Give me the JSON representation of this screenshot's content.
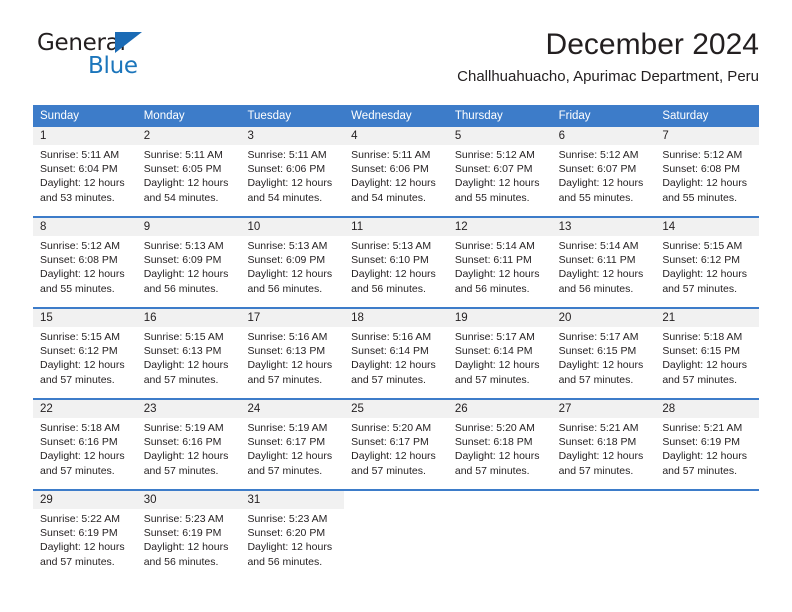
{
  "brand": {
    "name_top": "General",
    "name_bottom": "Blue",
    "triangle_color": "#1b6bb5",
    "blue_color": "#1b75bb"
  },
  "header": {
    "title": "December 2024",
    "location": "Challhuahuacho, Apurimac Department, Peru"
  },
  "calendar": {
    "header_color": "#3d7cc9",
    "daynum_bg": "#f1f1f1",
    "weekdays": [
      "Sunday",
      "Monday",
      "Tuesday",
      "Wednesday",
      "Thursday",
      "Friday",
      "Saturday"
    ],
    "weeks": [
      [
        {
          "day": "1",
          "sunrise": "Sunrise: 5:11 AM",
          "sunset": "Sunset: 6:04 PM",
          "daylight1": "Daylight: 12 hours",
          "daylight2": "and 53 minutes."
        },
        {
          "day": "2",
          "sunrise": "Sunrise: 5:11 AM",
          "sunset": "Sunset: 6:05 PM",
          "daylight1": "Daylight: 12 hours",
          "daylight2": "and 54 minutes."
        },
        {
          "day": "3",
          "sunrise": "Sunrise: 5:11 AM",
          "sunset": "Sunset: 6:06 PM",
          "daylight1": "Daylight: 12 hours",
          "daylight2": "and 54 minutes."
        },
        {
          "day": "4",
          "sunrise": "Sunrise: 5:11 AM",
          "sunset": "Sunset: 6:06 PM",
          "daylight1": "Daylight: 12 hours",
          "daylight2": "and 54 minutes."
        },
        {
          "day": "5",
          "sunrise": "Sunrise: 5:12 AM",
          "sunset": "Sunset: 6:07 PM",
          "daylight1": "Daylight: 12 hours",
          "daylight2": "and 55 minutes."
        },
        {
          "day": "6",
          "sunrise": "Sunrise: 5:12 AM",
          "sunset": "Sunset: 6:07 PM",
          "daylight1": "Daylight: 12 hours",
          "daylight2": "and 55 minutes."
        },
        {
          "day": "7",
          "sunrise": "Sunrise: 5:12 AM",
          "sunset": "Sunset: 6:08 PM",
          "daylight1": "Daylight: 12 hours",
          "daylight2": "and 55 minutes."
        }
      ],
      [
        {
          "day": "8",
          "sunrise": "Sunrise: 5:12 AM",
          "sunset": "Sunset: 6:08 PM",
          "daylight1": "Daylight: 12 hours",
          "daylight2": "and 55 minutes."
        },
        {
          "day": "9",
          "sunrise": "Sunrise: 5:13 AM",
          "sunset": "Sunset: 6:09 PM",
          "daylight1": "Daylight: 12 hours",
          "daylight2": "and 56 minutes."
        },
        {
          "day": "10",
          "sunrise": "Sunrise: 5:13 AM",
          "sunset": "Sunset: 6:09 PM",
          "daylight1": "Daylight: 12 hours",
          "daylight2": "and 56 minutes."
        },
        {
          "day": "11",
          "sunrise": "Sunrise: 5:13 AM",
          "sunset": "Sunset: 6:10 PM",
          "daylight1": "Daylight: 12 hours",
          "daylight2": "and 56 minutes."
        },
        {
          "day": "12",
          "sunrise": "Sunrise: 5:14 AM",
          "sunset": "Sunset: 6:11 PM",
          "daylight1": "Daylight: 12 hours",
          "daylight2": "and 56 minutes."
        },
        {
          "day": "13",
          "sunrise": "Sunrise: 5:14 AM",
          "sunset": "Sunset: 6:11 PM",
          "daylight1": "Daylight: 12 hours",
          "daylight2": "and 56 minutes."
        },
        {
          "day": "14",
          "sunrise": "Sunrise: 5:15 AM",
          "sunset": "Sunset: 6:12 PM",
          "daylight1": "Daylight: 12 hours",
          "daylight2": "and 57 minutes."
        }
      ],
      [
        {
          "day": "15",
          "sunrise": "Sunrise: 5:15 AM",
          "sunset": "Sunset: 6:12 PM",
          "daylight1": "Daylight: 12 hours",
          "daylight2": "and 57 minutes."
        },
        {
          "day": "16",
          "sunrise": "Sunrise: 5:15 AM",
          "sunset": "Sunset: 6:13 PM",
          "daylight1": "Daylight: 12 hours",
          "daylight2": "and 57 minutes."
        },
        {
          "day": "17",
          "sunrise": "Sunrise: 5:16 AM",
          "sunset": "Sunset: 6:13 PM",
          "daylight1": "Daylight: 12 hours",
          "daylight2": "and 57 minutes."
        },
        {
          "day": "18",
          "sunrise": "Sunrise: 5:16 AM",
          "sunset": "Sunset: 6:14 PM",
          "daylight1": "Daylight: 12 hours",
          "daylight2": "and 57 minutes."
        },
        {
          "day": "19",
          "sunrise": "Sunrise: 5:17 AM",
          "sunset": "Sunset: 6:14 PM",
          "daylight1": "Daylight: 12 hours",
          "daylight2": "and 57 minutes."
        },
        {
          "day": "20",
          "sunrise": "Sunrise: 5:17 AM",
          "sunset": "Sunset: 6:15 PM",
          "daylight1": "Daylight: 12 hours",
          "daylight2": "and 57 minutes."
        },
        {
          "day": "21",
          "sunrise": "Sunrise: 5:18 AM",
          "sunset": "Sunset: 6:15 PM",
          "daylight1": "Daylight: 12 hours",
          "daylight2": "and 57 minutes."
        }
      ],
      [
        {
          "day": "22",
          "sunrise": "Sunrise: 5:18 AM",
          "sunset": "Sunset: 6:16 PM",
          "daylight1": "Daylight: 12 hours",
          "daylight2": "and 57 minutes."
        },
        {
          "day": "23",
          "sunrise": "Sunrise: 5:19 AM",
          "sunset": "Sunset: 6:16 PM",
          "daylight1": "Daylight: 12 hours",
          "daylight2": "and 57 minutes."
        },
        {
          "day": "24",
          "sunrise": "Sunrise: 5:19 AM",
          "sunset": "Sunset: 6:17 PM",
          "daylight1": "Daylight: 12 hours",
          "daylight2": "and 57 minutes."
        },
        {
          "day": "25",
          "sunrise": "Sunrise: 5:20 AM",
          "sunset": "Sunset: 6:17 PM",
          "daylight1": "Daylight: 12 hours",
          "daylight2": "and 57 minutes."
        },
        {
          "day": "26",
          "sunrise": "Sunrise: 5:20 AM",
          "sunset": "Sunset: 6:18 PM",
          "daylight1": "Daylight: 12 hours",
          "daylight2": "and 57 minutes."
        },
        {
          "day": "27",
          "sunrise": "Sunrise: 5:21 AM",
          "sunset": "Sunset: 6:18 PM",
          "daylight1": "Daylight: 12 hours",
          "daylight2": "and 57 minutes."
        },
        {
          "day": "28",
          "sunrise": "Sunrise: 5:21 AM",
          "sunset": "Sunset: 6:19 PM",
          "daylight1": "Daylight: 12 hours",
          "daylight2": "and 57 minutes."
        }
      ],
      [
        {
          "day": "29",
          "sunrise": "Sunrise: 5:22 AM",
          "sunset": "Sunset: 6:19 PM",
          "daylight1": "Daylight: 12 hours",
          "daylight2": "and 57 minutes."
        },
        {
          "day": "30",
          "sunrise": "Sunrise: 5:23 AM",
          "sunset": "Sunset: 6:19 PM",
          "daylight1": "Daylight: 12 hours",
          "daylight2": "and 56 minutes."
        },
        {
          "day": "31",
          "sunrise": "Sunrise: 5:23 AM",
          "sunset": "Sunset: 6:20 PM",
          "daylight1": "Daylight: 12 hours",
          "daylight2": "and 56 minutes."
        },
        {
          "day": "",
          "sunrise": "",
          "sunset": "",
          "daylight1": "",
          "daylight2": ""
        },
        {
          "day": "",
          "sunrise": "",
          "sunset": "",
          "daylight1": "",
          "daylight2": ""
        },
        {
          "day": "",
          "sunrise": "",
          "sunset": "",
          "daylight1": "",
          "daylight2": ""
        },
        {
          "day": "",
          "sunrise": "",
          "sunset": "",
          "daylight1": "",
          "daylight2": ""
        }
      ]
    ]
  }
}
